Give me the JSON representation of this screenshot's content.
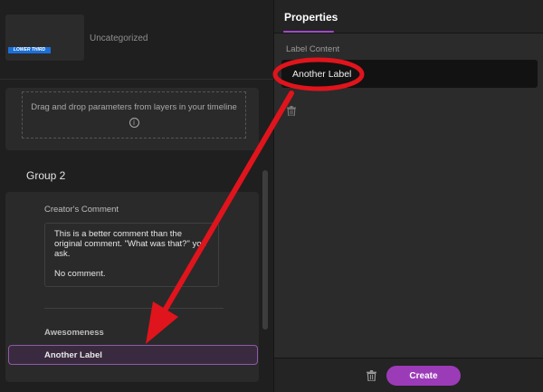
{
  "left": {
    "thumbnail_text": "LOWER THIRD",
    "category": "Uncategorized",
    "dropzone_text": "Drag and drop parameters from layers in your timeline",
    "info_glyph": "i",
    "group2": {
      "title": "Group 2",
      "comment_label": "Creator's Comment",
      "comment_paragraphs": [
        "This is a better comment than the original comment. \"What was that?\" you ask.",
        "No comment."
      ],
      "awesomeness_label": "Awesomeness",
      "label_item": "Another Label"
    }
  },
  "right": {
    "tab": "Properties",
    "field_label": "Label Content",
    "label_value": "Another Label",
    "create_label": "Create"
  },
  "colors": {
    "accent": "#9c3bb8",
    "annotation": "#e0141c"
  },
  "icons": [
    "info-icon",
    "trash-icon"
  ]
}
